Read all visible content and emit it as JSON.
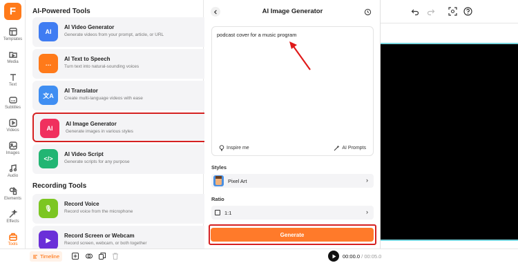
{
  "logo": "F",
  "rail": [
    {
      "label": "Templates",
      "icon": "templates-icon"
    },
    {
      "label": "Media",
      "icon": "media-icon"
    },
    {
      "label": "Text",
      "icon": "text-icon"
    },
    {
      "label": "Subtitles",
      "icon": "subtitles-icon"
    },
    {
      "label": "Videos",
      "icon": "videos-icon"
    },
    {
      "label": "Images",
      "icon": "images-icon"
    },
    {
      "label": "Audio",
      "icon": "audio-icon"
    },
    {
      "label": "Elements",
      "icon": "elements-icon"
    },
    {
      "label": "Effects",
      "icon": "effects-icon"
    },
    {
      "label": "Tools",
      "icon": "tools-icon",
      "active": true
    }
  ],
  "tools_panel": {
    "ai_section_title": "AI-Powered Tools",
    "ai_tools": [
      {
        "title": "AI Video Generator",
        "desc": "Generate videos from your prompt, article, or URL",
        "icon": "ai-video-icon",
        "color": "#3f7cf2",
        "glyph": "AI"
      },
      {
        "title": "AI Text to Speech",
        "desc": "Turn text into natural-sounding voices",
        "icon": "text-to-speech-icon",
        "color": "#ff7a1a",
        "glyph": "…"
      },
      {
        "title": "AI Translator",
        "desc": "Create multi-language videos with ease",
        "icon": "translator-icon",
        "color": "#3f8ef2",
        "glyph": "文A"
      },
      {
        "title": "AI Image Generator",
        "desc": "Generate images in various styles",
        "icon": "image-generator-icon",
        "color": "#f0305e",
        "glyph": "AI",
        "selected": true
      },
      {
        "title": "AI Video Script",
        "desc": "Generate scripts for any purpose",
        "icon": "video-script-icon",
        "color": "#22b573",
        "glyph": "</>"
      }
    ],
    "rec_section_title": "Recording Tools",
    "rec_tools": [
      {
        "title": "Record Voice",
        "desc": "Record voice from the microphone",
        "icon": "microphone-icon",
        "color": "#7cc622",
        "glyph": "🎙"
      },
      {
        "title": "Record Screen or Webcam",
        "desc": "Record screen, webcam, or both together",
        "icon": "screen-record-icon",
        "color": "#6a2fd8",
        "glyph": "▶"
      }
    ]
  },
  "generator": {
    "title": "AI Image Generator",
    "prompt": "podcast cover for a music program",
    "inspire_label": "Inspire me",
    "ai_prompts_label": "AI Prompts",
    "styles_label": "Styles",
    "style_value": "Pixel Art",
    "ratio_label": "Ratio",
    "ratio_value": "1:1",
    "generate_label": "Generate"
  },
  "timeline": {
    "tab_label": "Timeline",
    "current_time": "00:00.0",
    "separator": "/",
    "total_time": "00:05.0"
  },
  "colors": {
    "accent": "#ff7a1a",
    "highlight": "#d52020"
  }
}
